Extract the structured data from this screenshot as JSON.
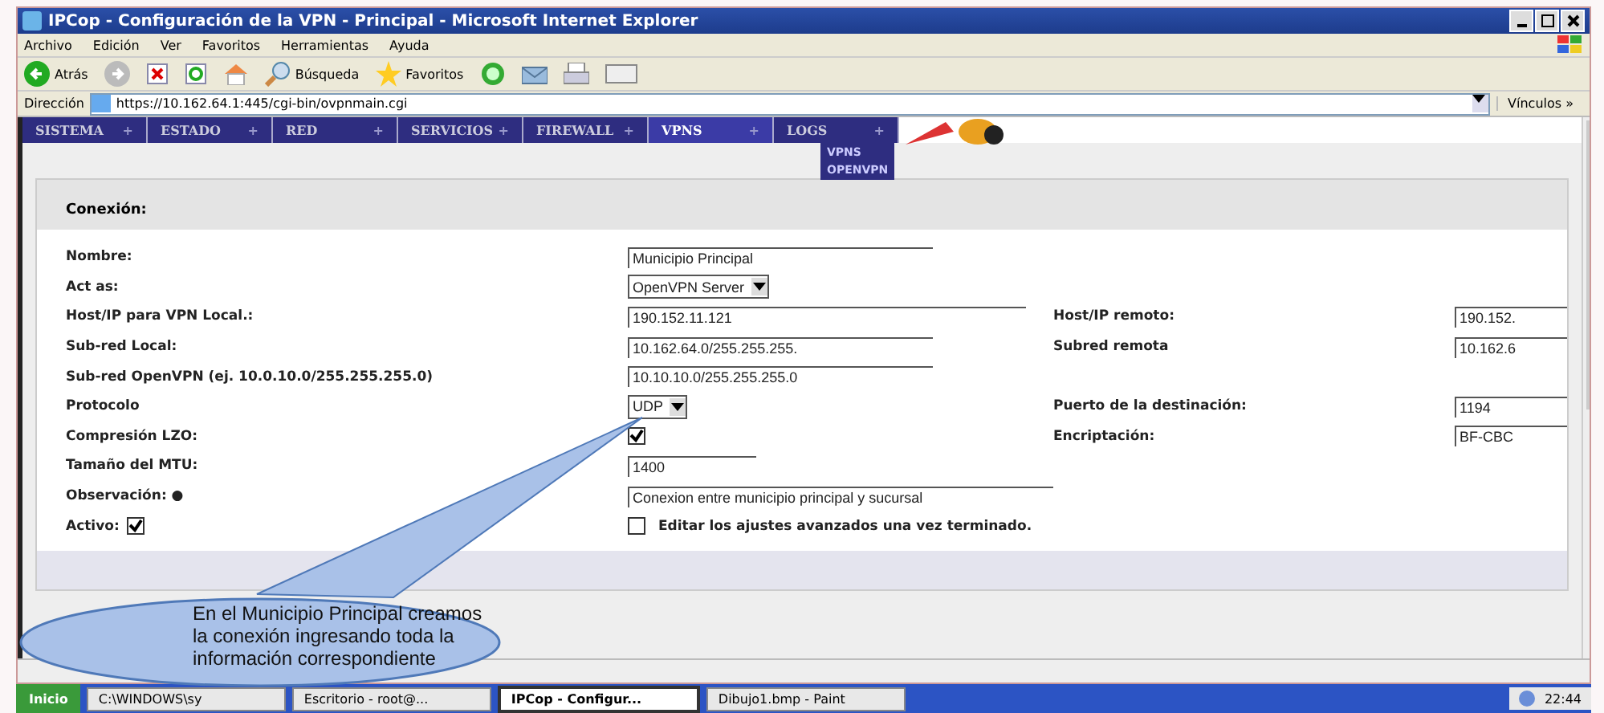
{
  "window": {
    "title": "IPCop - Configuración de la VPN - Principal - Microsoft Internet Explorer"
  },
  "menu": [
    "Archivo",
    "Edición",
    "Ver",
    "Favoritos",
    "Herramientas",
    "Ayuda"
  ],
  "toolbar": {
    "back": "Atrás",
    "search": "Búsqueda",
    "favorites": "Favoritos"
  },
  "address": {
    "label": "Dirección",
    "url": "https://10.162.64.1:445/cgi-bin/ovpnmain.cgi",
    "links": "Vínculos",
    "links_arrow": "»"
  },
  "nav_tabs": [
    {
      "label": "SISTEMA",
      "plus": "+",
      "selected": false
    },
    {
      "label": "ESTADO",
      "plus": "+",
      "selected": false
    },
    {
      "label": "RED",
      "plus": "+",
      "selected": false
    },
    {
      "label": "SERVICIOS",
      "plus": "+",
      "selected": false
    },
    {
      "label": "FIREWALL",
      "plus": "+",
      "selected": false
    },
    {
      "label": "VPNS",
      "plus": "+",
      "selected": true
    },
    {
      "label": "LOGS",
      "plus": "+",
      "selected": false
    }
  ],
  "dropdown": [
    "VPNS",
    "OPENVPN"
  ],
  "section": {
    "title": "Conexión:"
  },
  "rows": [
    {
      "label": "Nombre:",
      "field": {
        "kind": "text",
        "value": "Municipio Principal"
      }
    },
    {
      "label": "Act as:",
      "field": {
        "kind": "select",
        "value": "OpenVPN Server"
      }
    },
    {
      "label": "Host/IP para VPN Local.:",
      "field": {
        "kind": "text",
        "value": "190.152.11.121"
      },
      "remote": {
        "label": "Host/IP remoto:",
        "value": "190.152."
      }
    },
    {
      "label": "Sub-red Local:",
      "field": {
        "kind": "text",
        "value": "10.162.64.0/255.255.255."
      },
      "remote": {
        "label": "Subred remota",
        "value": "10.162.6"
      }
    },
    {
      "label": "Sub-red OpenVPN (ej. 10.0.10.0/255.255.255.0)",
      "field": {
        "kind": "text",
        "value": "10.10.10.0/255.255.255.0"
      }
    },
    {
      "label": "Protocolo",
      "field": {
        "kind": "select",
        "value": "UDP"
      },
      "remote": {
        "label": "Puerto de la destinación:",
        "value": "1194"
      }
    },
    {
      "label": "Compresión LZO:",
      "field": {
        "kind": "checkbox",
        "checked": true
      },
      "remote": {
        "label": "Encriptación:",
        "value": "BF-CBC"
      }
    },
    {
      "label": "Tamaño del MTU:",
      "field": {
        "kind": "text",
        "value": "1400"
      }
    },
    {
      "label": "Observación: ●",
      "field": {
        "kind": "text",
        "value": "Conexion entre municipio principal y sucursal"
      }
    },
    {
      "label": "Activo:",
      "inline_checked": true,
      "field": {
        "kind": "option",
        "checked": false,
        "text": "Editar los ajustes avanzados una vez terminado."
      }
    }
  ],
  "callout": {
    "text": "En el Municipio Principal creamos  la conexión  ingresando toda la información correspondiente"
  },
  "taskbar": {
    "start": "Inicio",
    "items": [
      {
        "label": "C:\\WINDOWS\\sy",
        "selected": false
      },
      {
        "label": "Escritorio - root@...",
        "selected": false
      },
      {
        "label": "IPCop - Configur...",
        "selected": true
      },
      {
        "label": "Dibujo1.bmp - Paint",
        "selected": false
      }
    ],
    "clock": "22:44"
  }
}
